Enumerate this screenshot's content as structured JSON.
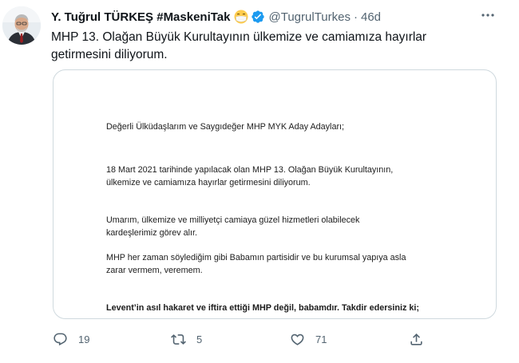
{
  "tweet": {
    "author_name": "Y. Tuğrul TÜRKEŞ #MaskeniTak",
    "handle": "@TugrulTurkes",
    "separator": "·",
    "time": "46d",
    "text": "MHP 13. Olağan Büyük Kurultayının ülkemize ve camiamıza hayırlar getirmesini diliyorum.",
    "icons": {
      "emoji": "face-with-mask-emoji",
      "verified": "verified-badge-icon",
      "more": "more-icon"
    },
    "colors": {
      "verified": "#1d9bf0",
      "secondary_text": "#536471",
      "border": "#cfd9de"
    }
  },
  "letter": {
    "salutation": "Değerli Ülküdaşlarım ve Saygıdeğer MHP MYK Aday Adayları;",
    "para1_line1": "18 Mart 2021 tarihinde yapılacak olan MHP 13. Olağan Büyük Kurultayının,",
    "para1_line2": "ülkemize ve camiamıza hayırlar getirmesini diliyorum.",
    "para2_line1": "Umarım, ülkemize ve milliyetçi camiaya güzel hizmetleri olabilecek",
    "para2_line2": "kardeşlerimiz görev alır.",
    "para3_line1": "MHP her zaman söylediğim gibi Babamın partisidir ve bu kurumsal yapıya asla",
    "para3_line2": "zarar vermem, veremem.",
    "bold_line": "Levent’in asıl hakaret ve iftira ettiği MHP değil, babamdır. Takdir edersiniz ki;"
  },
  "actions": {
    "reply": {
      "icon": "reply-icon",
      "count": "19"
    },
    "retweet": {
      "icon": "retweet-icon",
      "count": "5"
    },
    "like": {
      "icon": "like-icon",
      "count": "71"
    },
    "share": {
      "icon": "share-icon"
    }
  }
}
